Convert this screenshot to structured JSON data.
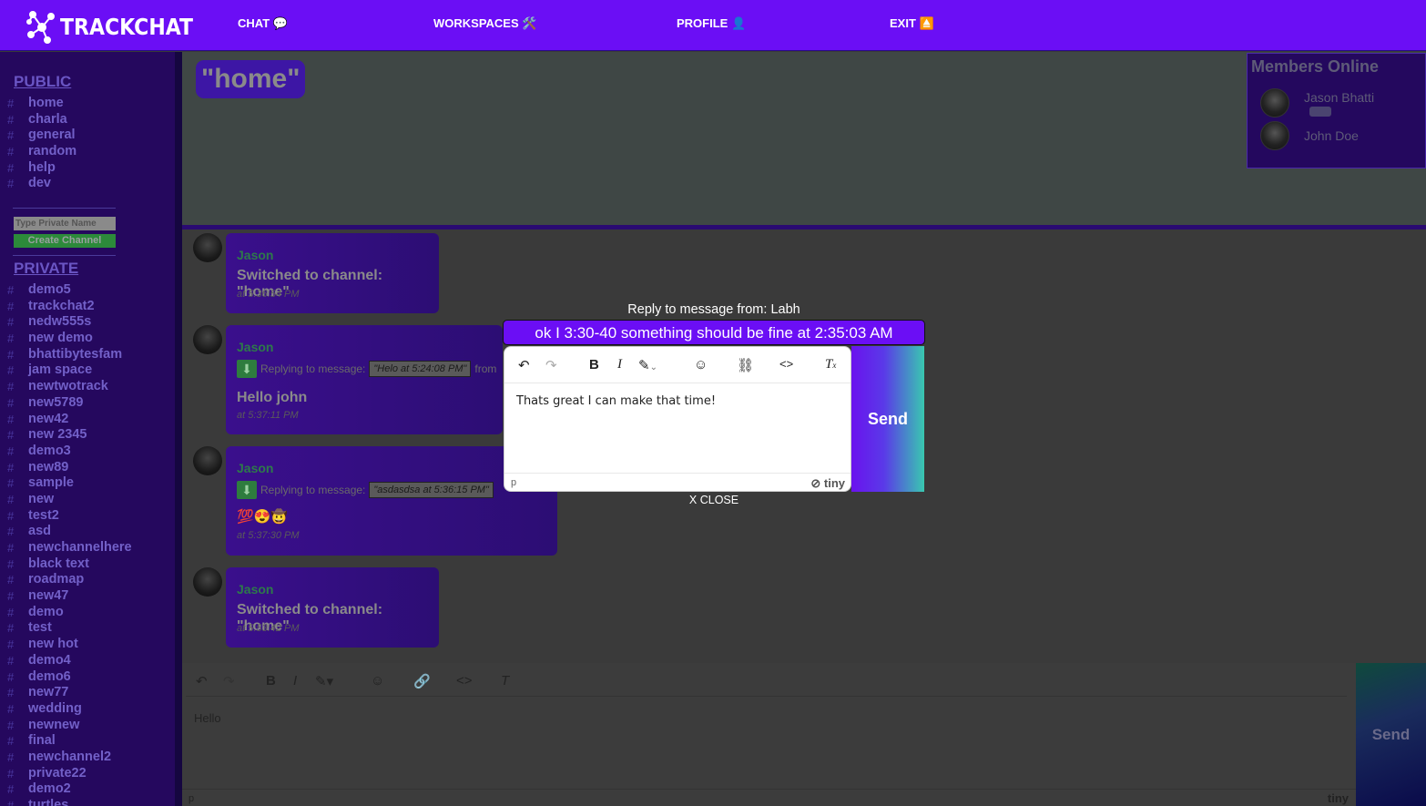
{
  "app": {
    "brand": "TRACKCHAT",
    "nav": [
      {
        "label": "CHAT 💬"
      },
      {
        "label": "WORKSPACES 🛠️"
      },
      {
        "label": "PROFILE 👤"
      },
      {
        "label": "EXIT ⏏️"
      }
    ]
  },
  "sidebar": {
    "public_title": "PUBLIC",
    "public_channels": [
      "home",
      "charla",
      "general",
      "random",
      "help",
      "dev"
    ],
    "private_placeholder": "Type Private Name",
    "create_label": "Create Channel",
    "private_title": "PRIVATE",
    "private_channels": [
      "demo5",
      "trackchat2",
      "nedw555s",
      "new demo",
      "bhattibytesfam",
      "jam space",
      "newtwotrack",
      "new5789",
      "new42",
      "new 2345",
      "demo3",
      "new89",
      "sample",
      "new",
      "test2",
      "asd",
      "newchannelhere",
      "black text",
      "roadmap",
      "new47",
      "demo",
      "test",
      "new hot",
      "demo4",
      "demo6",
      "new77",
      "wedding",
      "newnew",
      "final",
      "newchannel2",
      "private22",
      "demo2",
      "turtles"
    ],
    "hash_symbol": "#"
  },
  "channel": {
    "title": "\"home\""
  },
  "members": {
    "title": "Members Online",
    "list": [
      {
        "name": "Jason Bhatti",
        "badge": "🎮"
      },
      {
        "name": "John Doe"
      }
    ]
  },
  "messages": [
    {
      "sender": "Jason",
      "text_prefix": "Switched to channel: ",
      "text_bold": "\"home\"",
      "time": "at 5:36:54 PM"
    },
    {
      "sender": "Jason",
      "reply_label": "Replying to message:",
      "reply_quote": "\"Helo at 5:24:08 PM\"",
      "reply_suffix": "from",
      "text": "Hello john",
      "time": "at 5:37:11 PM"
    },
    {
      "sender": "Jason",
      "reply_label": "Replying to message:",
      "reply_quote": "\"asdasdsa at 5:36:15 PM\"",
      "text": "💯😍🤠",
      "time": "at 5:37:30 PM"
    },
    {
      "sender": "Jason",
      "text_prefix": "Switched to channel: ",
      "text_bold": "\"home\"",
      "time": "at 5:53:42 PM"
    }
  ],
  "bottom_editor": {
    "text": "Hello",
    "status": "p",
    "brand": "tiny",
    "send_label": "Send"
  },
  "modal": {
    "heading": "Reply to message from: Labh",
    "quoted": "ok I 3:30-40 something should be fine at 2:35:03 AM",
    "editor_text": "Thats great I can make that time!",
    "status": "p",
    "brand": "tiny",
    "send_label": "Send",
    "close_label": "X CLOSE"
  }
}
